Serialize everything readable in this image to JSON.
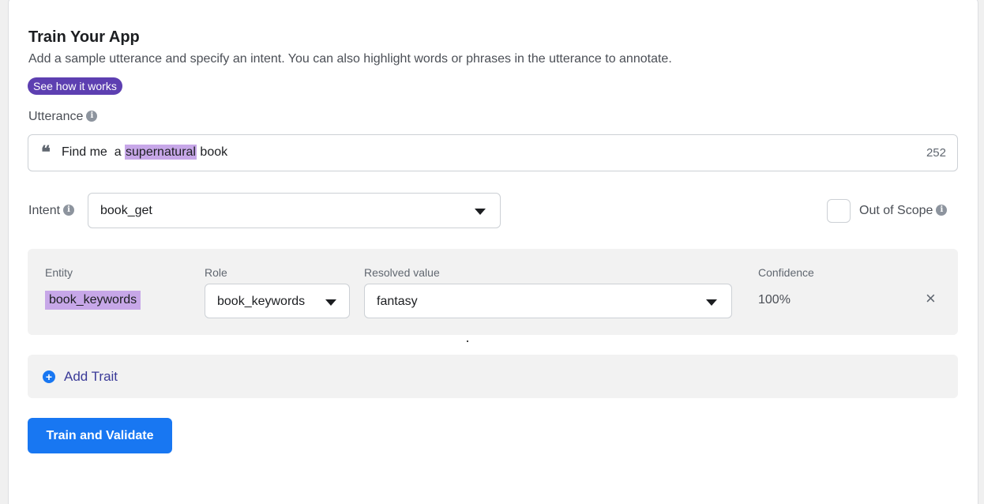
{
  "header": {
    "title": "Train Your App",
    "subtitle": "Add a sample utterance and specify an intent. You can also highlight words or phrases in the utterance to annotate.",
    "help_pill": "See how it works"
  },
  "utterance": {
    "label": "Utterance",
    "text_before": "Find me  a ",
    "highlighted": "supernatural",
    "text_after": " book",
    "char_count": "252"
  },
  "intent": {
    "label": "Intent",
    "value": "book_get",
    "out_of_scope_label": "Out of Scope",
    "out_of_scope_checked": false
  },
  "entity": {
    "headers": {
      "entity": "Entity",
      "role": "Role",
      "resolved": "Resolved value",
      "confidence": "Confidence"
    },
    "entity_value": "book_keywords",
    "role_value": "book_keywords",
    "resolved_value": "fantasy",
    "confidence_value": "100%",
    "remove_icon": "×"
  },
  "trait": {
    "add_label": "Add Trait"
  },
  "actions": {
    "train_label": "Train and Validate"
  },
  "colors": {
    "accent": "#1877f2",
    "pill": "#5d3fb1",
    "highlight": "#c7a7e8"
  },
  "info_icon": "i"
}
